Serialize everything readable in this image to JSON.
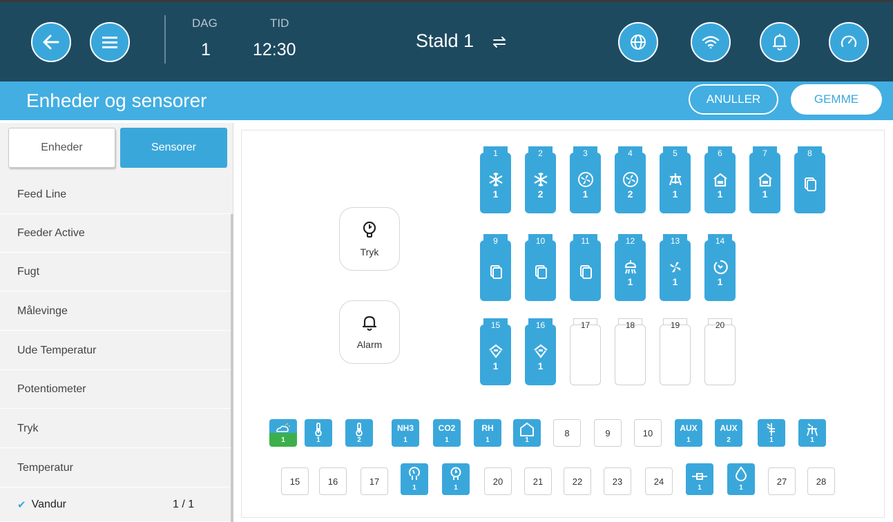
{
  "header": {
    "day_label": "DAG",
    "day_value": "1",
    "time_label": "TID",
    "time_value": "12:30",
    "house": "Stald 1"
  },
  "titlebar": {
    "title": "Enheder og sensorer",
    "cancel": "ANULLER",
    "save": "GEMME"
  },
  "tabs": {
    "units": "Enheder",
    "sensors": "Sensorer"
  },
  "sidebar": {
    "items": [
      {
        "label": "Feed Line"
      },
      {
        "label": "Feeder Active"
      },
      {
        "label": "Fugt"
      },
      {
        "label": "Målevinge"
      },
      {
        "label": "Ude Temperatur"
      },
      {
        "label": "Potentiometer"
      },
      {
        "label": "Tryk"
      },
      {
        "label": "Temperatur"
      }
    ],
    "selected": {
      "label": "Vandur",
      "count": "1 / 1"
    }
  },
  "cards": {
    "pressure": "Tryk",
    "alarm": "Alarm"
  },
  "slots": {
    "s1": {
      "num": "1",
      "sub": "1"
    },
    "s2": {
      "num": "2",
      "sub": "2"
    },
    "s3": {
      "num": "3",
      "sub": "1"
    },
    "s4": {
      "num": "4",
      "sub": "2"
    },
    "s5": {
      "num": "5",
      "sub": "1"
    },
    "s6": {
      "num": "6",
      "sub": "1"
    },
    "s7": {
      "num": "7",
      "sub": "1"
    },
    "s8": {
      "num": "8"
    },
    "s9": {
      "num": "9"
    },
    "s10": {
      "num": "10"
    },
    "s11": {
      "num": "11"
    },
    "s12": {
      "num": "12",
      "sub": "1"
    },
    "s13": {
      "num": "13",
      "sub": "1"
    },
    "s14": {
      "num": "14",
      "sub": "1"
    },
    "s15": {
      "num": "15",
      "sub": "1"
    },
    "s16": {
      "num": "16",
      "sub": "1"
    },
    "s17": {
      "num": "17"
    },
    "s18": {
      "num": "18"
    },
    "s19": {
      "num": "19"
    },
    "s20": {
      "num": "20"
    }
  },
  "inputs_row1": {
    "i1": "1",
    "i2": "1",
    "i3": "2",
    "i4": {
      "t": "NH3",
      "s": "1"
    },
    "i5": {
      "t": "CO2",
      "s": "1"
    },
    "i6": {
      "t": "RH",
      "s": "1"
    },
    "i7": "1",
    "i8": "8",
    "i9": "9",
    "i10": "10",
    "i11": {
      "t": "AUX",
      "s": "1"
    },
    "i12": {
      "t": "AUX",
      "s": "2"
    },
    "i13": "1",
    "i14": "1"
  },
  "inputs_row2": {
    "i15": "15",
    "i16": "16",
    "i17": "17",
    "i18": "1",
    "i19": "1",
    "i20": "20",
    "i21": "21",
    "i22": "22",
    "i23": "23",
    "i24": "24",
    "i25": "1",
    "i26": "1",
    "i27": "27",
    "i28": "28"
  }
}
